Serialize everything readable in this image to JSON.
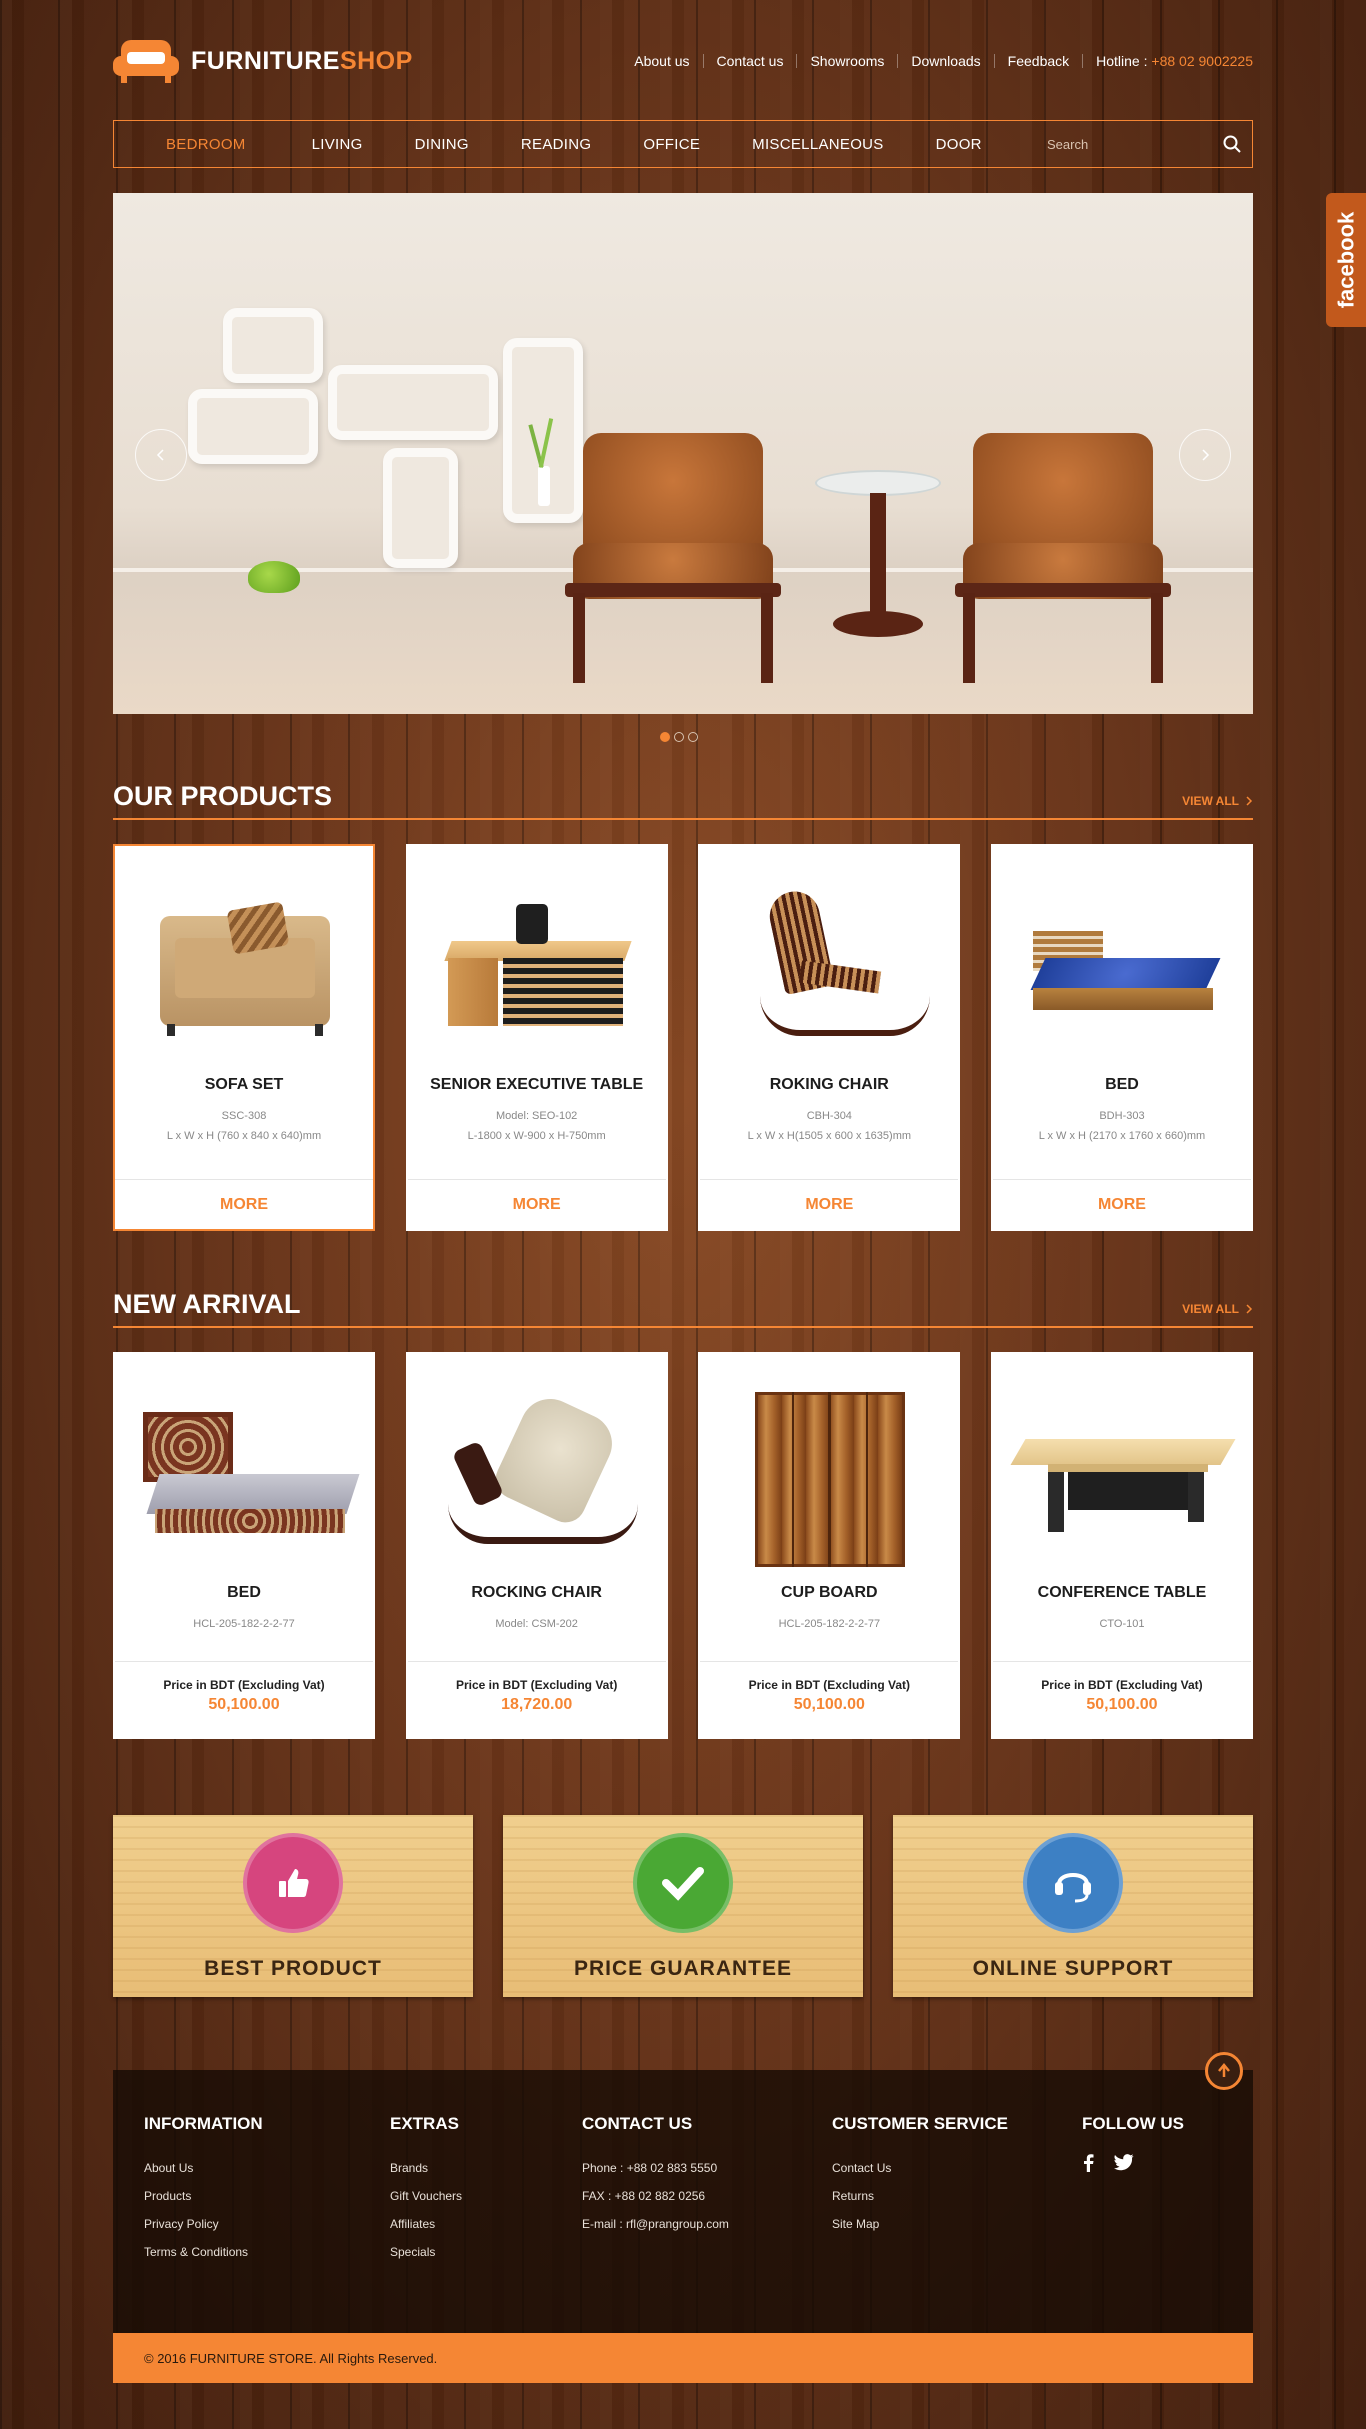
{
  "brand": {
    "name_part1": "FURNITURE",
    "name_part2": "SHOP"
  },
  "top_links": [
    "About us",
    "Contact us",
    "Showrooms",
    "Downloads",
    "Feedback"
  ],
  "hotline": {
    "label": "Hotline :",
    "number": "+88 02 9002225"
  },
  "nav": {
    "items": [
      "BEDROOM",
      "LIVING",
      "DINING",
      "READING",
      "OFFICE",
      "MISCELLANEOUS",
      "DOOR"
    ],
    "active": "BEDROOM",
    "search_placeholder": "Search"
  },
  "facebook_tab": "facebook",
  "slider": {
    "slide_count": 3,
    "active_slide": 1
  },
  "our_products": {
    "title": "OUR PRODUCTS",
    "view_all": "VIEW ALL",
    "items": [
      {
        "name": "SOFA SET",
        "model": "SSC-308",
        "dims": "L x W x H (760 x 840 x 640)mm",
        "action": "MORE"
      },
      {
        "name": "SENIOR EXECUTIVE TABLE",
        "model": "Model: SEO-102",
        "dims": "L-1800 x W-900 x H-750mm",
        "action": "MORE"
      },
      {
        "name": "ROKING CHAIR",
        "model": "CBH-304",
        "dims": "L x W x H(1505 x 600 x 1635)mm",
        "action": "MORE"
      },
      {
        "name": "BED",
        "model": "BDH-303",
        "dims": "L x W x H (2170 x 1760 x 660)mm",
        "action": "MORE"
      }
    ]
  },
  "new_arrival": {
    "title": "NEW ARRIVAL",
    "view_all": "VIEW ALL",
    "price_label": "Price in BDT (Excluding Vat)",
    "items": [
      {
        "name": "BED",
        "model": "HCL-205-182-2-2-77",
        "price": "50,100.00"
      },
      {
        "name": "ROCKING CHAIR",
        "model": "Model: CSM-202",
        "price": "18,720.00"
      },
      {
        "name": "CUP BOARD",
        "model": "HCL-205-182-2-2-77",
        "price": "50,100.00"
      },
      {
        "name": "CONFERENCE TABLE",
        "model": "CTO-101",
        "price": "50,100.00"
      }
    ]
  },
  "features": [
    {
      "label": "BEST PRODUCT",
      "icon": "thumbs-up-icon",
      "color": "#d6457e"
    },
    {
      "label": "PRICE GUARANTEE",
      "icon": "check-icon",
      "color": "#4aa834"
    },
    {
      "label": "ONLINE SUPPORT",
      "icon": "headset-icon",
      "color": "#3d80c4"
    }
  ],
  "footer": {
    "information": {
      "title": "INFORMATION",
      "links": [
        "About Us",
        "Products",
        "Privacy Policy",
        "Terms & Conditions"
      ]
    },
    "extras": {
      "title": "EXTRAS",
      "links": [
        "Brands",
        "Gift Vouchers",
        "Affiliates",
        "Specials"
      ]
    },
    "contact": {
      "title": "CONTACT US",
      "lines": [
        "Phone : +88 02 883 5550",
        "FAX : +88 02 882 0256",
        "E-mail : rfl@prangroup.com"
      ]
    },
    "customer_service": {
      "title": "CUSTOMER SERVICE",
      "links": [
        "Contact Us",
        "Returns",
        "Site Map"
      ]
    },
    "follow": {
      "title": "FOLLOW US",
      "icons": [
        "facebook-icon",
        "twitter-icon"
      ]
    },
    "copyright": "© 2016 FURNITURE STORE. All Rights Reserved."
  },
  "colors": {
    "accent": "#f58634",
    "wood_dark": "#5a2d15"
  }
}
